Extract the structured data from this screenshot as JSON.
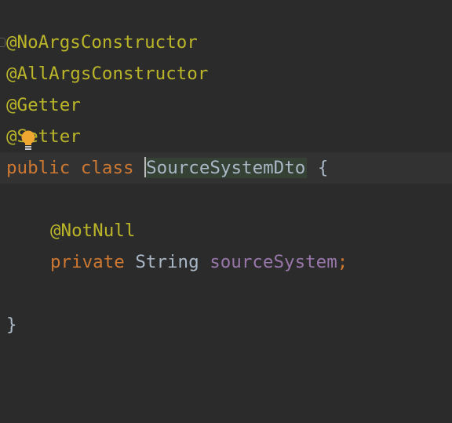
{
  "editor": {
    "lines": {
      "l1": {
        "annotation": "@NoArgsConstructor"
      },
      "l2": {
        "annotation": "@AllArgsConstructor"
      },
      "l3": {
        "annotation": "@Getter"
      },
      "l4": {
        "annotation": "@Setter"
      },
      "l5": {
        "kw_public": "public",
        "kw_class": "class",
        "class_name": "SourceSystemDto",
        "open_brace": "{"
      },
      "l7": {
        "annotation": "@NotNull"
      },
      "l8": {
        "kw_private": "private",
        "type": "String",
        "field": "sourceSystem",
        "semicolon": ";"
      },
      "l10": {
        "close_brace": "}"
      }
    },
    "icons": {
      "intention_bulb": "lightbulb-icon",
      "fold": "fold-marker-icon"
    },
    "colors": {
      "background": "#2b2b2b",
      "annotation": "#bbb529",
      "keyword": "#cc7832",
      "field": "#9876aa",
      "text": "#a9b7c6",
      "bulb": "#f0a732"
    }
  }
}
